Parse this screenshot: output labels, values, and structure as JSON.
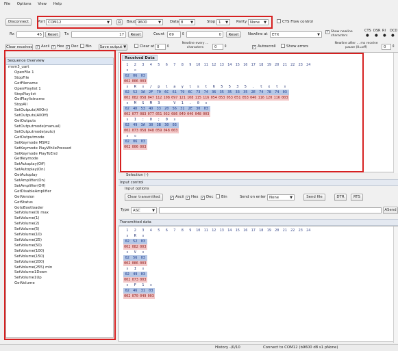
{
  "menu": [
    "File",
    "Options",
    "View",
    "Help"
  ],
  "toolbar": {
    "disconnect": "Disconnect",
    "port_label": "Port",
    "port_value": "COM12",
    "r_button": "R",
    "baud_label": "Baud",
    "baud_value": "9600",
    "data_label": "Data",
    "data_value": "8",
    "stop_label": "Stop",
    "stop_value": "1",
    "parity_label": "Parity",
    "parity_value": "None",
    "cts_label": "CTS Flow control"
  },
  "counters": {
    "rx_label": "Rx",
    "rx_value": "45",
    "reset1": "Reset",
    "tx_label": "Tx",
    "tx_value": "17",
    "reset2": "Reset",
    "count_label": "Count",
    "count_value": "69",
    "count_val2": "0",
    "reset3": "Reset",
    "newline_at_label": "Newline at",
    "newline_at_value": "ETX",
    "show_newline": "Show newline characters",
    "signals": [
      "CTS",
      "DSR",
      "RI",
      "DCD"
    ]
  },
  "options": {
    "clear_received": "Clear received",
    "ascii": "Ascii",
    "hex": "Hex",
    "dec": "Dec",
    "bin": "Bin",
    "save_output": "Save output",
    "clear_at": "Clear at",
    "clear_at_value": "0",
    "newline_every": "Newline every ... characters",
    "newline_every_value": "0",
    "autoscroll": "Autoscroll",
    "show_errors": "Show errors",
    "newline_after": "Newline after ... ms receive pause (0=off)",
    "newline_after_value": "0"
  },
  "sequence": {
    "header": "Sequence Overview",
    "title": "msm3_uart",
    "items": [
      "OpenFile 1",
      "StopFile",
      "GetFilename",
      "OpenPlaylist 1",
      "StopPlaylist",
      "GetPlaylistname",
      "StopAll",
      "SetOutputs(AllOn)",
      "SetOutputs(AllOff)",
      "GetOutputs",
      "SetOutputmode(manual)",
      "SetOutputmode(auto)",
      "GetOutputmode",
      "SetKeymode MSM2",
      "SetKeymode PlayWhilePressed",
      "SetKeymode PlayToEnd",
      "GetKeymode",
      "SetAutoplay(Off)",
      "SetAutoplay(On)",
      "GetAutoplay",
      "SetAmplifier(On)",
      "SetAmplifier(Off)",
      "GetDisableAmplifier",
      "GetVersion",
      "GetStatus",
      "GotoBootloader",
      "SetVolume(0) max",
      "SetVolume(1)",
      "SetVolume(2)",
      "SetVolume(5)",
      "SetVolume(10)",
      "SetVolume(25)",
      "SetVolume(50)",
      "SetVolume(100)",
      "SetVolume(150)",
      "SetVolume(200)",
      "SetVolume(255) min",
      "SetVolume1Down",
      "SetVolume1Up",
      "GetVolume"
    ]
  },
  "received": {
    "header": "Received Data",
    "columns": [
      "1",
      "2",
      "3",
      "4",
      "5",
      "6",
      "7",
      "8",
      "9",
      "10",
      "11",
      "12",
      "13",
      "14",
      "15",
      "16",
      "17",
      "18",
      "19",
      "20",
      "21",
      "22",
      "23",
      "24"
    ],
    "blocks": [
      {
        "ascii": [
          "¤",
          "¤",
          ""
        ],
        "hex": [
          "02",
          "06",
          "03"
        ],
        "dec": [
          "002",
          "006",
          "003"
        ]
      },
      {
        "ascii": [
          "¤",
          "R",
          "¤",
          "/",
          "p",
          "l",
          "a",
          "y",
          "l",
          "s",
          "t",
          "6",
          "5",
          "5",
          "3",
          "5",
          ".",
          "t",
          "x",
          "t",
          "¤"
        ],
        "hex": [
          "02",
          "52",
          "3A",
          "2F",
          "70",
          "6C",
          "61",
          "79",
          "6C",
          "73",
          "74",
          "36",
          "35",
          "35",
          "33",
          "35",
          "2E",
          "74",
          "78",
          "74",
          "03"
        ],
        "dec": [
          "002",
          "082",
          "058",
          "047",
          "112",
          "108",
          "097",
          "121",
          "108",
          "115",
          "116",
          "054",
          "053",
          "053",
          "051",
          "053",
          "046",
          "116",
          "120",
          "116",
          "003"
        ]
      },
      {
        "ascii": [
          "¤",
          "M",
          "S",
          "M",
          "3",
          "",
          "V",
          "1",
          ".",
          "0",
          "¤"
        ],
        "hex": [
          "02",
          "4D",
          "53",
          "4D",
          "33",
          "20",
          "56",
          "31",
          "2E",
          "30",
          "03"
        ],
        "dec": [
          "002",
          "077",
          "083",
          "077",
          "051",
          "032",
          "086",
          "049",
          "046",
          "048",
          "003"
        ]
      },
      {
        "ascii": [
          "¤",
          "I",
          ":",
          "0",
          ";",
          "0",
          "¤"
        ],
        "hex": [
          "02",
          "49",
          "3A",
          "30",
          "3B",
          "30",
          "03"
        ],
        "dec": [
          "002",
          "073",
          "058",
          "048",
          "059",
          "048",
          "003"
        ]
      },
      {
        "ascii": [
          "¤",
          "¤",
          ""
        ],
        "hex": [
          "02",
          "06",
          "03"
        ],
        "dec": [
          "002",
          "006",
          "003"
        ]
      }
    ],
    "selection": "Selection (-)"
  },
  "input": {
    "section": "Input control",
    "options_label": "Input options",
    "clear_transmitted": "Clear transmitted",
    "ascii": "Ascii",
    "hex": "Hex",
    "dec": "Dec",
    "bin": "Bin",
    "send_on_enter": "Send on enter",
    "send_on_enter_value": "None",
    "send_file": "Send file",
    "dtr": "DTR",
    "rts": "RTS",
    "type_label": "Type",
    "type_value": "ASC",
    "asend": "ASend"
  },
  "transmitted": {
    "header": "Transmitted data",
    "columns": [
      "1",
      "2",
      "3",
      "4",
      "5",
      "6",
      "7",
      "8",
      "9",
      "10",
      "11",
      "12",
      "13",
      "14",
      "15",
      "16",
      "17",
      "18",
      "19",
      "20",
      "21",
      "22",
      "23",
      "24"
    ],
    "blocks": [
      {
        "ascii": [
          "¤",
          "R",
          "¤"
        ],
        "hex": [
          "02",
          "52",
          "03"
        ],
        "dec": [
          "002",
          "082",
          "003"
        ]
      },
      {
        "ascii": [
          "¤",
          "V",
          "¤"
        ],
        "hex": [
          "02",
          "56",
          "03"
        ],
        "dec": [
          "002",
          "086",
          "003"
        ]
      },
      {
        "ascii": [
          "¤",
          "I",
          "¤"
        ],
        "hex": [
          "02",
          "49",
          "03"
        ],
        "dec": [
          "002",
          "073",
          "003"
        ]
      },
      {
        "ascii": [
          "¤",
          "F",
          "1",
          "¤"
        ],
        "hex": [
          "02",
          "46",
          "31",
          "03"
        ],
        "dec": [
          "002",
          "070",
          "049",
          "003"
        ]
      }
    ]
  },
  "status": {
    "history": "History -/0/10",
    "connection": "Connect to COM12 (b9600 d8 s1 pNone)"
  }
}
